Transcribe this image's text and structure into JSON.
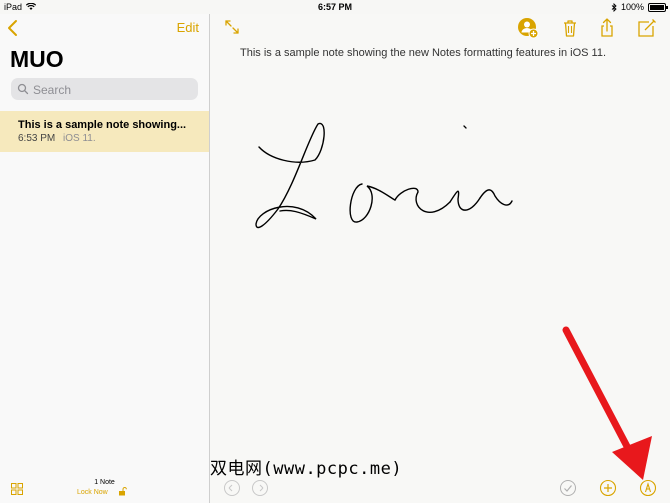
{
  "status_bar": {
    "device": "iPad",
    "time": "6:57 PM",
    "battery": "100%"
  },
  "sidebar": {
    "edit_label": "Edit",
    "folder_title": "MUO",
    "search_placeholder": "Search",
    "notes": [
      {
        "title": "This is a sample note showing...",
        "time": "6:53 PM",
        "preview": "iOS 11."
      }
    ],
    "footer": {
      "note_count": "1 Note",
      "lock_label": "Lock Now"
    }
  },
  "main": {
    "body_text": "This is a sample note showing the new Notes formatting features in iOS 11."
  },
  "watermark": "双电网(www.pcpc.me)",
  "colors": {
    "accent": "#d9a400",
    "selected_row": "#f6e9bd",
    "annotation_arrow": "#e8181c"
  }
}
